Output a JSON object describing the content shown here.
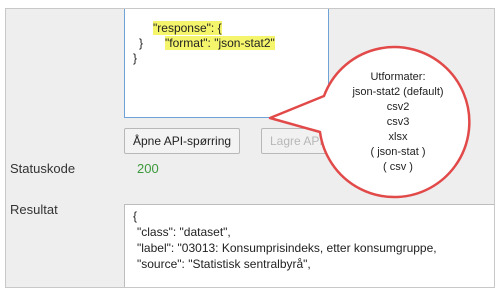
{
  "code_editor": {
    "lines": [
      "\"response\": {",
      "\"format\": \"json-stat2\"",
      "}",
      "}"
    ]
  },
  "buttons": {
    "open_api_query": "Åpne API-spørring",
    "second_button_partial": "Lagre API-spørring"
  },
  "status": {
    "label": "Statuskode",
    "value": "200"
  },
  "result": {
    "label": "Resultat",
    "lines": [
      "{",
      "\"class\": \"dataset\",",
      "\"label\": \"03013: Konsumprisindeks, etter konsumgruppe,",
      "\"source\": \"Statistisk sentralbyrå\","
    ]
  },
  "tooltip": {
    "lines": [
      "Utformater:",
      "json-stat2 (default)",
      "csv2",
      "csv3",
      "xlsx",
      "( json-stat )",
      "( csv )"
    ]
  },
  "colors": {
    "highlight": "#f5f56b",
    "editor_border": "#6fa3d8",
    "status_ok": "#3c9a3c",
    "tooltip_border": "#e24a4a"
  }
}
